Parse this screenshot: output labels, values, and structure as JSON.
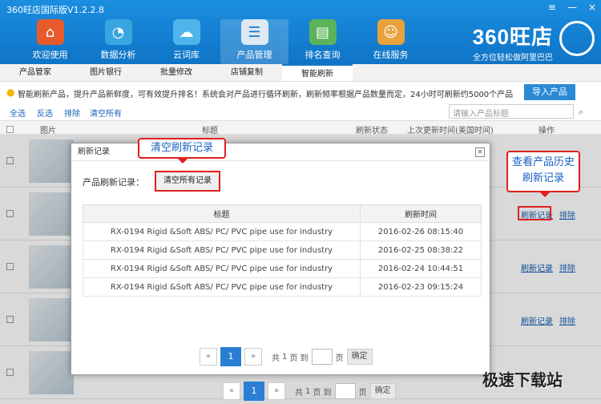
{
  "app": {
    "title": "360旺店国际版V1.2.2.8",
    "window_controls": [
      "≡",
      "—",
      "×"
    ]
  },
  "toolbar": [
    {
      "label": "欢迎使用",
      "icon": "home-icon"
    },
    {
      "label": "数据分析",
      "icon": "pie-chart-icon"
    },
    {
      "label": "云词库",
      "icon": "cloud-icon"
    },
    {
      "label": "产品管理",
      "icon": "clipboard-icon"
    },
    {
      "label": "排名查询",
      "icon": "rank-chart-icon"
    },
    {
      "label": "在线服务",
      "icon": "support-person-icon"
    }
  ],
  "brand": {
    "name": "360旺店",
    "slogan": "全方位轻松做阿里巴巴"
  },
  "subnav": [
    "产品管家",
    "图片银行",
    "批量修改",
    "店铺复制",
    "智能刷新"
  ],
  "info": {
    "text": "智能刷新产品，提升产品新鲜度，可有效提升排名！系统会对产品进行循环刷新，刷新频率根据产品数量而定，24小时可刷新约5000个产品",
    "import_button": "导入产品"
  },
  "actions": {
    "select_all": "全选",
    "invert": "反选",
    "exclude": "排除",
    "clear_all": "清空所有",
    "search_placeholder": "请输入产品标题"
  },
  "table": {
    "headers": [
      "图片",
      "标题",
      "刷新状态",
      "上次更新时间(美国时间)",
      "操作"
    ],
    "row_ops": {
      "records": "刷新记录",
      "exclude": "排除"
    }
  },
  "modal": {
    "title": "刷新记录",
    "label": "产品刷新记录：",
    "clear_button": "清空所有记录",
    "columns": [
      "标题",
      "刷新时间"
    ],
    "rows": [
      {
        "title": "RX-0194 Rigid &Soft ABS/ PC/ PVC pipe use for industry",
        "time": "2016-02-26 08:15:40"
      },
      {
        "title": "RX-0194 Rigid &Soft ABS/ PC/ PVC pipe use for industry",
        "time": "2016-02-25 08:38:22"
      },
      {
        "title": "RX-0194 Rigid &Soft ABS/ PC/ PVC pipe use for industry",
        "time": "2016-02-24 10:44:51"
      },
      {
        "title": "RX-0194 Rigid &Soft ABS/ PC/ PVC pipe use for industry",
        "time": "2016-02-23 09:15:24"
      }
    ],
    "pager": {
      "prev": "«",
      "current": "1",
      "next": "»",
      "total_prefix": "共",
      "total": "1",
      "total_suffix": "页 到",
      "page_unit": "页",
      "go": "确定"
    }
  },
  "callouts": {
    "clear": "清空刷新记录",
    "history": "查看产品历史刷新记录"
  },
  "watermark": "极速下载站"
}
